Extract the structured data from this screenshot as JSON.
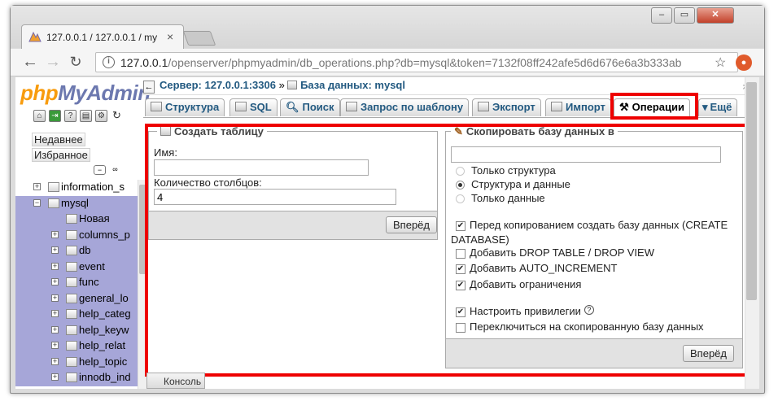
{
  "browser": {
    "tab_title": "127.0.0.1 / 127.0.0.1 / my",
    "tab_close": "×",
    "url_host": "127.0.0.1",
    "url_path": "/openserver/phpmyadmin/db_operations.php?db=mysql&token=7132f08ff242afe5d6d676e6a3b333ab",
    "window_buttons": [
      "‒",
      "▭",
      "✕"
    ]
  },
  "sidebar": {
    "logo_php": "php",
    "logo_myadmin": "MyAdmin",
    "recent": "Недавнее",
    "favorites": "Избранное",
    "tree": [
      {
        "label": "information_s",
        "level": 0,
        "exp": "+"
      },
      {
        "label": "mysql",
        "level": 0,
        "exp": "−",
        "hl": true
      },
      {
        "label": "Новая",
        "level": 1,
        "exp": "",
        "hl": true
      },
      {
        "label": "columns_p",
        "level": 1,
        "exp": "+",
        "hl": true
      },
      {
        "label": "db",
        "level": 1,
        "exp": "+",
        "hl": true
      },
      {
        "label": "event",
        "level": 1,
        "exp": "+",
        "hl": true
      },
      {
        "label": "func",
        "level": 1,
        "exp": "+",
        "hl": true
      },
      {
        "label": "general_lo",
        "level": 1,
        "exp": "+",
        "hl": true
      },
      {
        "label": "help_categ",
        "level": 1,
        "exp": "+",
        "hl": true
      },
      {
        "label": "help_keyw",
        "level": 1,
        "exp": "+",
        "hl": true
      },
      {
        "label": "help_relat",
        "level": 1,
        "exp": "+",
        "hl": true
      },
      {
        "label": "help_topic",
        "level": 1,
        "exp": "+",
        "hl": true
      },
      {
        "label": "innodb_ind",
        "level": 1,
        "exp": "+",
        "hl": true
      }
    ]
  },
  "breadcrumb": {
    "server": "Сервер: 127.0.0.1:3306",
    "sep": "»",
    "database": "База данных: mysql"
  },
  "tabs": {
    "structure": "Структура",
    "sql": "SQL",
    "search": "Поиск",
    "query": "Запрос по шаблону",
    "export": "Экспорт",
    "import": "Импорт",
    "operations": "Операции",
    "more": "Ещё"
  },
  "create_table": {
    "legend": "Создать таблицу",
    "name_label": "Имя:",
    "name_value": "",
    "columns_label": "Количество столбцов:",
    "columns_value": "4",
    "go": "Вперёд"
  },
  "copy_db": {
    "legend": "Скопировать базу данных в",
    "name_value": "",
    "radio_structure_only": "Только структура",
    "radio_structure_data": "Структура и данные",
    "radio_data_only": "Только данные",
    "cb_create_db_line1": "Перед копированием создать базу данных (CREATE",
    "cb_create_db_line2": "DATABASE)",
    "cb_drop": "Добавить DROP TABLE / DROP VIEW",
    "cb_auto_inc": "Добавить AUTO_INCREMENT",
    "cb_constraints": "Добавить ограничения",
    "cb_privileges": "Настроить привилегии",
    "cb_switch": "Переключиться на скопированную базу данных",
    "go": "Вперёд"
  },
  "console": "Консоль",
  "colors": {
    "highlight_red": "#ee0000",
    "link_blue": "#235a81",
    "tree_selected": "#a6a6d8"
  }
}
